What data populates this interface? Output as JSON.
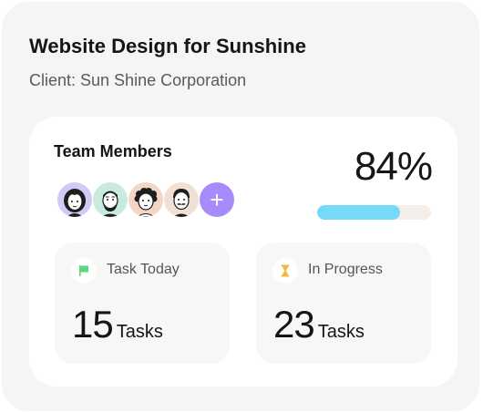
{
  "project": {
    "title": "Website Design for Sunshine",
    "client": "Client: Sun Shine Corporation"
  },
  "team": {
    "label": "Team Members",
    "members": [
      {
        "avatar": "woman-avatar-icon",
        "bg": "#cfcaf6"
      },
      {
        "avatar": "bearded-man-avatar-icon",
        "bg": "#c9ebdd"
      },
      {
        "avatar": "curly-hair-avatar-icon",
        "bg": "#f3d6c3"
      },
      {
        "avatar": "mustache-man-avatar-icon",
        "bg": "#f1e0d3"
      }
    ],
    "add_label": "+",
    "add_color": "#a78bfa"
  },
  "progress": {
    "percent_label": "84%",
    "value": 0.73,
    "fill_color": "#76d9f7",
    "track_color": "#f3eeea"
  },
  "stats": [
    {
      "icon": "flag-icon",
      "label": "Task Today",
      "value": "15",
      "unit": "Tasks"
    },
    {
      "icon": "hourglass-icon",
      "label": "In Progress",
      "value": "23",
      "unit": "Tasks"
    }
  ]
}
